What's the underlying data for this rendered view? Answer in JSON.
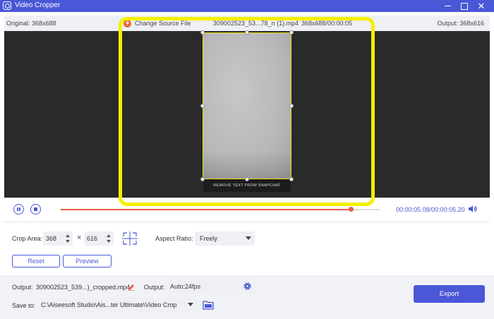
{
  "window": {
    "title": "Video Cropper",
    "minimize_icon": "minimize-icon",
    "maximize_icon": "maximize-icon",
    "close_glyph": "✕"
  },
  "info_bar": {
    "original": "Original: 368x688",
    "change_source": "Change Source File",
    "file_name": "309002523_53...78_n (1).mp4",
    "file_meta": "368x688/00:00:05",
    "output": "Output: 368x616"
  },
  "preview": {
    "caption": "REMOVE TEXT FROM SNAPCHAT",
    "crop_color": "#f0e000",
    "highlight_color": "#f4f000"
  },
  "playback": {
    "current_time": "00:00:05.08",
    "total_time": "/00:00:05.20",
    "progress": 0.91
  },
  "crop": {
    "area_label": "Crop Area:",
    "width": "368",
    "times": "×",
    "height": "616",
    "aspect_label": "Aspect Ratio:",
    "aspect_value": "Freely",
    "reset_label": "Reset",
    "preview_label": "Preview"
  },
  "output": {
    "file_label": "Output:",
    "file_name": "309002523_539...)_cropped.mp4",
    "format_label": "Output:",
    "format_value": "Auto;24fps",
    "save_label": "Save to:",
    "save_path": "C:\\Aiseesoft Studio\\Ais...ter Ultimate\\Video Crop",
    "export_label": "Export"
  },
  "colors": {
    "accent": "#4a57d6",
    "progress": "#e85c4a",
    "add_button": "#e96a35"
  }
}
